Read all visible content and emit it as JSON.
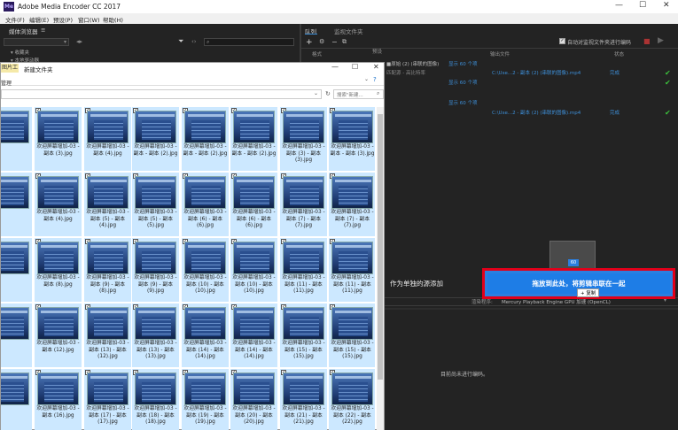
{
  "app": {
    "logo_text": "Me",
    "title": "Adobe Media Encoder CC 2017",
    "window_controls": [
      "—",
      "☐",
      "✕"
    ],
    "menu": [
      "文件(F)",
      "编辑(E)",
      "预设(P)",
      "窗口(W)",
      "帮助(H)"
    ]
  },
  "media_browser": {
    "tab": "媒体浏览器",
    "tab_menu": "≡",
    "tree": [
      "收藏夹",
      "本地驱动器"
    ]
  },
  "queue": {
    "tabs": [
      "队列",
      "监视文件夹"
    ],
    "auto_encode_label": "自动对监视文件夹进行编码",
    "columns": {
      "format": "格式",
      "preset": "预设",
      "output": "输出文件",
      "status": "状态"
    },
    "rows": [
      {
        "name": "■原始 (2) (串联的图像)",
        "duration": "显示 60 个项",
        "preset": "匹配源 - 高比特率",
        "output": "C:\\Use...2 - 副本 (2) (串联的图像).mp4",
        "status": "完成"
      },
      {
        "name": "■原始 (2) (串联的图像)",
        "duration": "显示 60 个项",
        "preset": "匹配源 - 高比特率",
        "output": "C:\\Use...2 - 副本 (2) (串联的图像).mp4",
        "status": "完成"
      }
    ]
  },
  "explorer": {
    "ribbon_tab": "图片工具",
    "title": "新建文件夹",
    "manage_label": "管理",
    "search_placeholder": "搜索\"新建...",
    "thumbs": [
      "欢迎屏幕增加-03 - 副本 (3).jpg",
      "欢迎屏幕增加-03 - 副本 (4).jpg",
      "欢迎屏幕增加-03 - 副本 - 副本 (2).jpg",
      "欢迎屏幕增加-03 - 副本 - 副本 (2).jpg",
      "欢迎屏幕增加-03 - 副本 - 副本 (2).jpg",
      "欢迎屏幕增加-03 - 副本 (3) - 副本 (3).jpg",
      "欢迎屏幕增加-03 - 副本 - 副本 (3).jpg",
      "欢迎屏幕增加-03 - 副本 (4).jpg",
      "欢迎屏幕增加-03 - 副本 (5) - 副本 (4).jpg",
      "欢迎屏幕增加-03 - 副本 (5) - 副本 (5).jpg",
      "欢迎屏幕增加-03 - 副本 (6) - 副本 (6).jpg",
      "欢迎屏幕增加-03 - 副本 (6) - 副本 (6).jpg",
      "欢迎屏幕增加-03 - 副本 (7) - 副本 (7).jpg",
      "欢迎屏幕增加-03 - 副本 (7) - 副本 (7).jpg",
      "欢迎屏幕增加-03 - 副本 (8).jpg",
      "欢迎屏幕增加-03 - 副本 (9) - 副本 (8).jpg",
      "欢迎屏幕增加-03 - 副本 (9) - 副本 (9).jpg",
      "欢迎屏幕增加-03 - 副本 (10) - 副本 (10).jpg",
      "欢迎屏幕增加-03 - 副本 (10) - 副本 (10).jpg",
      "欢迎屏幕增加-03 - 副本 (11) - 副本 (11).jpg",
      "欢迎屏幕增加-03 - 副本 (11) - 副本 (11).jpg",
      "欢迎屏幕增加-03 - 副本 (12).jpg",
      "欢迎屏幕增加-03 - 副本 (13) - 副本 (12).jpg",
      "欢迎屏幕增加-03 - 副本 (13) - 副本 (13).jpg",
      "欢迎屏幕增加-03 - 副本 (14) - 副本 (14).jpg",
      "欢迎屏幕增加-03 - 副本 (14) - 副本 (14).jpg",
      "欢迎屏幕增加-03 - 副本 (15) - 副本 (15).jpg",
      "欢迎屏幕增加-03 - 副本 (15) - 副本 (15).jpg",
      "欢迎屏幕增加-03 - 副本 (16).jpg",
      "欢迎屏幕增加-03 - 副本 (17) - 副本 (17).jpg",
      "欢迎屏幕增加-03 - 副本 (18) - 副本 (18).jpg",
      "欢迎屏幕增加-03 - 副本 (19) - 副本 (19).jpg",
      "欢迎屏幕增加-03 - 副本 (20) - 副本 (20).jpg",
      "欢迎屏幕增加-03 - 副本 (21) - 副本 (21).jpg",
      "欢迎屏幕增加-03 - 副本 (22) - 副本 (22).jpg"
    ]
  },
  "drop": {
    "separate_label": "作为单独的源添加",
    "zone_text": "拖放到此处，将剪辑串联在一起",
    "badge": "60",
    "copy_tooltip": "+ 复制"
  },
  "renderer": {
    "label": "渲染程序:",
    "value": "Mercury Playback Engine GPU 加速 (OpenCL)"
  },
  "encoding_status": "目前尚未进行编码。",
  "colors": {
    "accent_blue": "#1e7de6",
    "highlight_red": "#e2001a",
    "done_green": "#3cc13c",
    "selected_thumb": "#cce8ff"
  }
}
